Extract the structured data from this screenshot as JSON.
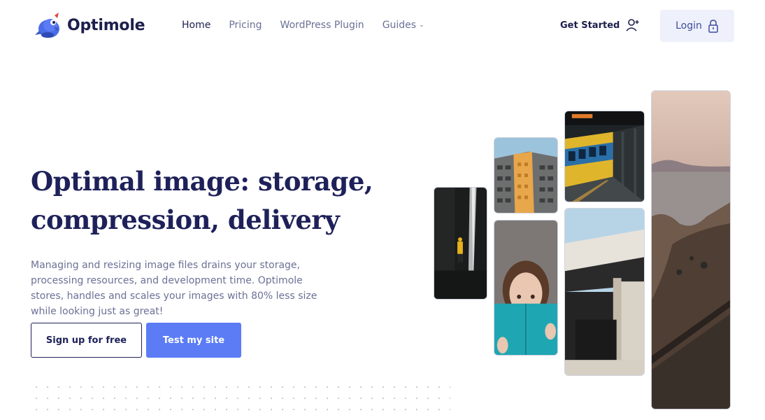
{
  "brand": {
    "name": "Optimole",
    "accent": "#5b7cf5",
    "dark": "#1e2159"
  },
  "nav": {
    "items": [
      {
        "label": "Home",
        "active": true
      },
      {
        "label": "Pricing",
        "active": false
      },
      {
        "label": "WordPress Plugin",
        "active": false
      },
      {
        "label": "Guides",
        "active": false,
        "has_dropdown": true
      }
    ],
    "get_started": "Get Started",
    "login": "Login"
  },
  "hero": {
    "title_line1": "Optimal image: storage,",
    "title_line2": "compression, delivery",
    "subtitle": "Managing and resizing image files drains your storage, processing resources, and development time. Optimole stores, handles and scales your images with 80% less size while looking just as great!",
    "cta_primary": "Test my site",
    "cta_secondary": "Sign up for free"
  },
  "gallery": {
    "photos": [
      {
        "name": "waterfall-photo",
        "subject": "person at waterfall"
      },
      {
        "name": "building-photo",
        "subject": "tall building"
      },
      {
        "name": "woman-book-photo",
        "subject": "woman holding book"
      },
      {
        "name": "train-photo",
        "subject": "train at station"
      },
      {
        "name": "bridge-photo",
        "subject": "concrete bridge"
      },
      {
        "name": "coast-photo",
        "subject": "coastal cliffs"
      }
    ]
  },
  "icons": {
    "logo": "optimole-mascot-icon",
    "dropdown": "chevron-down-icon",
    "get_started": "user-plus-icon",
    "login": "lock-icon"
  }
}
